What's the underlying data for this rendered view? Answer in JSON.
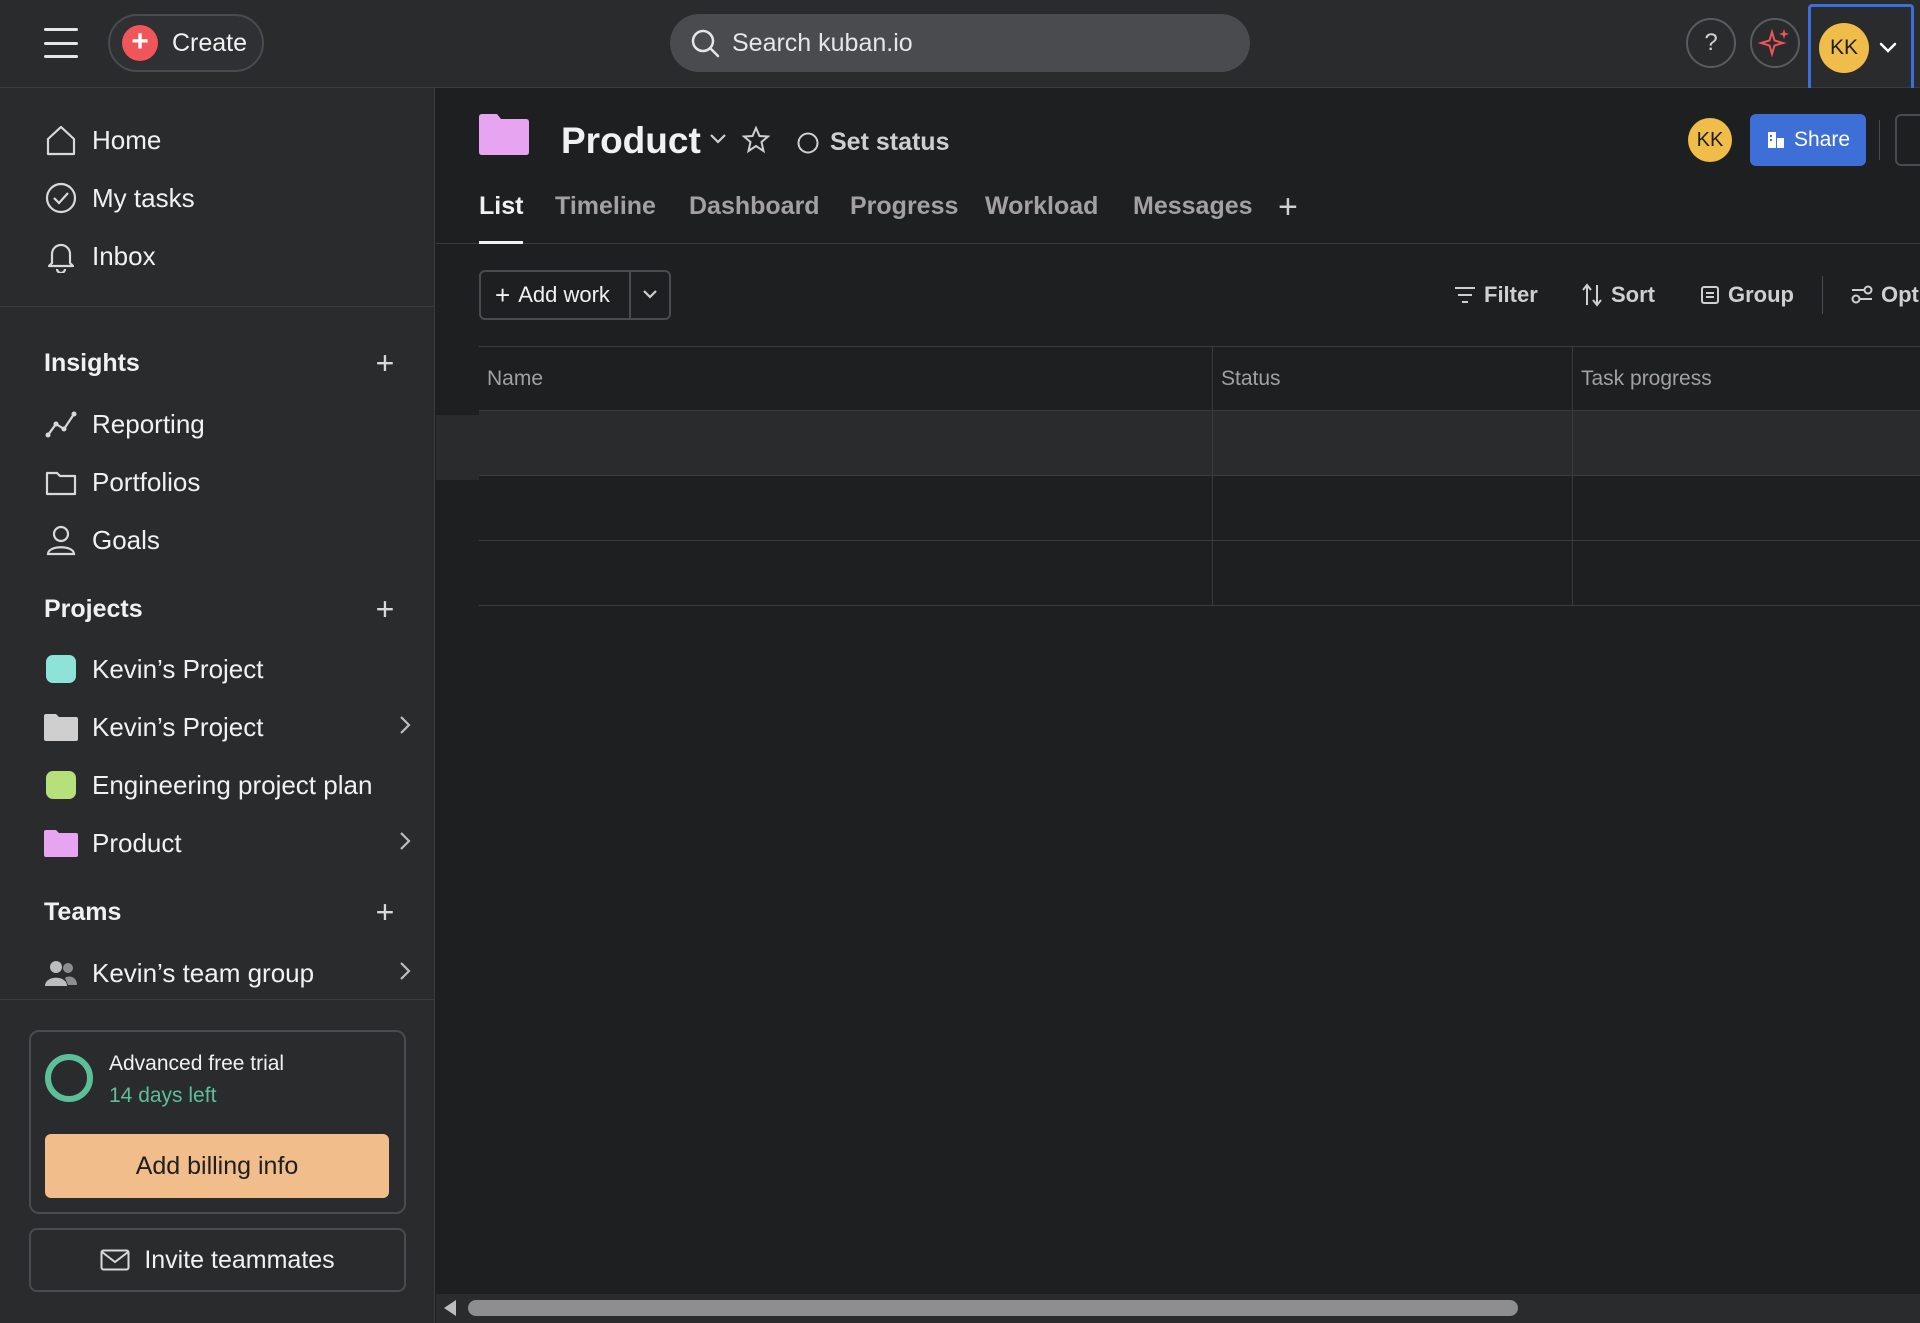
{
  "topbar": {
    "create_label": "Create",
    "search_placeholder": "Search kuban.io",
    "help_label": "?",
    "account_initials": "KK"
  },
  "sidebar": {
    "nav": [
      {
        "label": "Home",
        "icon": "home-icon"
      },
      {
        "label": "My tasks",
        "icon": "check-circle-icon"
      },
      {
        "label": "Inbox",
        "icon": "bell-icon"
      }
    ],
    "insights": {
      "title": "Insights",
      "items": [
        {
          "label": "Reporting",
          "icon": "reporting-icon"
        },
        {
          "label": "Portfolios",
          "icon": "folder-icon"
        },
        {
          "label": "Goals",
          "icon": "goals-icon"
        }
      ]
    },
    "projects": {
      "title": "Projects",
      "items": [
        {
          "label": "Kevin’s Project",
          "color": "#8ee3d8",
          "kind": "swatch"
        },
        {
          "label": "Kevin’s Project",
          "color": "#cfcfcf",
          "kind": "folder"
        },
        {
          "label": "Engineering project plan",
          "color": "#b5e07a",
          "kind": "swatch"
        },
        {
          "label": "Product",
          "color": "#e7a4f0",
          "kind": "folder"
        }
      ]
    },
    "teams": {
      "title": "Teams",
      "items": [
        {
          "label": "Kevin’s team group",
          "icon": "team-icon"
        }
      ]
    },
    "trial": {
      "title": "Advanced free trial",
      "remaining": "14 days left",
      "billing_button": "Add billing info"
    },
    "invite_label": "Invite teammates"
  },
  "project": {
    "title": "Product",
    "folder_color": "#e7a4f0",
    "set_status_label": "Set status",
    "member_initials": "KK",
    "share_label": "Share",
    "tabs": [
      {
        "label": "List",
        "active": true
      },
      {
        "label": "Timeline",
        "active": false
      },
      {
        "label": "Dashboard",
        "active": false
      },
      {
        "label": "Progress",
        "active": false
      },
      {
        "label": "Workload",
        "active": false
      },
      {
        "label": "Messages",
        "active": false
      }
    ],
    "toolbar": {
      "add_work_label": "Add work",
      "filter_label": "Filter",
      "sort_label": "Sort",
      "group_label": "Group",
      "options_label": "Opt"
    },
    "table": {
      "columns": [
        "Name",
        "Status",
        "Task progress"
      ],
      "rows": [
        [
          "",
          "",
          ""
        ],
        [
          "",
          "",
          ""
        ],
        [
          "",
          "",
          ""
        ]
      ]
    }
  },
  "colors": {
    "accent_blue": "#3d6fd6",
    "avatar_yellow": "#f1bd4a",
    "trial_green": "#5dbf9a",
    "billing_orange": "#f1bd8a",
    "create_red": "#f0555a"
  }
}
